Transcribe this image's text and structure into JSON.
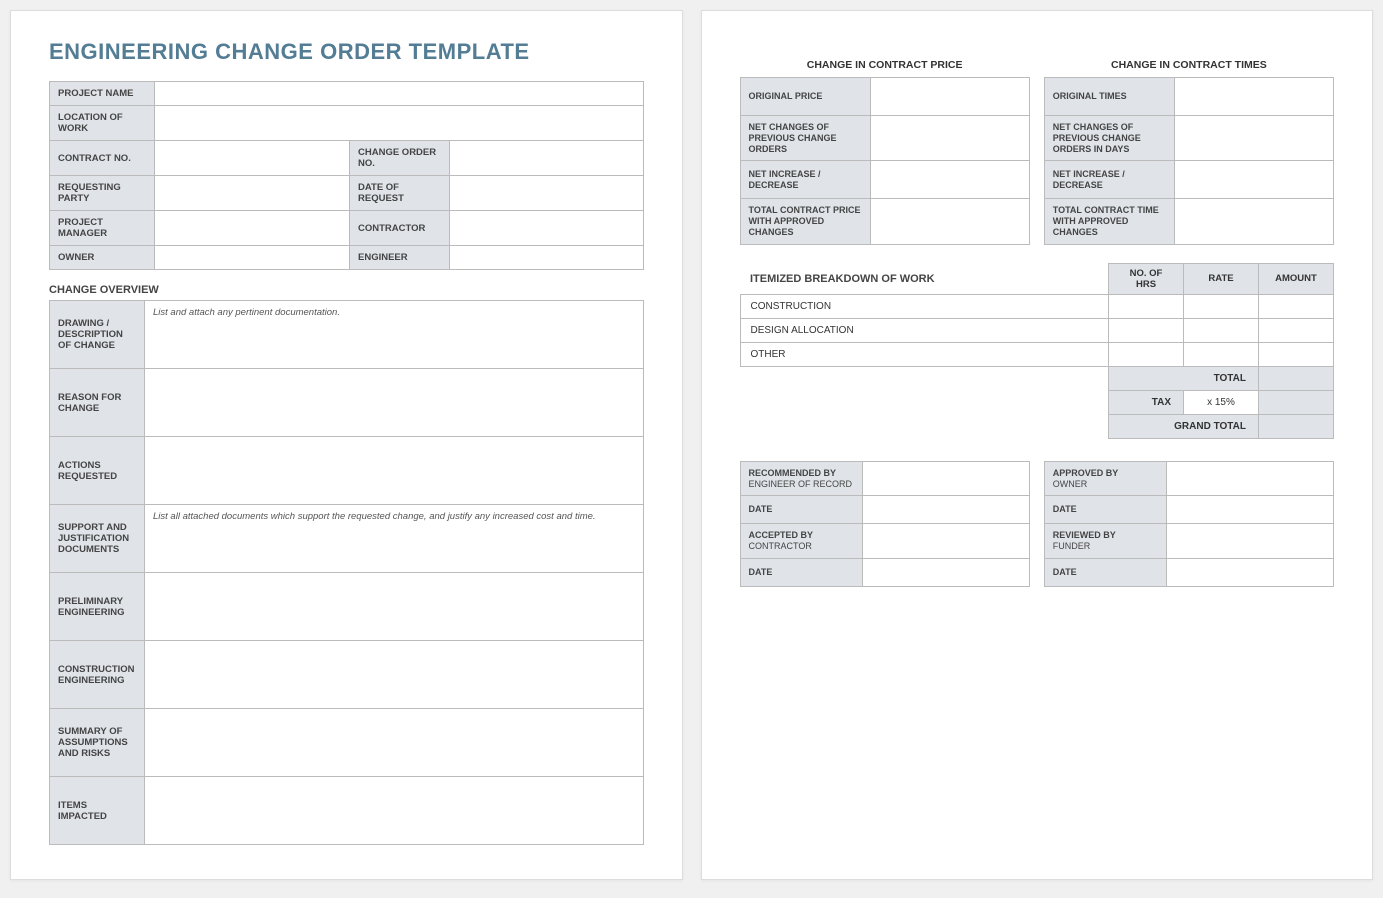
{
  "title": "ENGINEERING CHANGE ORDER TEMPLATE",
  "info": {
    "project_name_label": "PROJECT NAME",
    "project_name_value": "",
    "location_label": "LOCATION OF WORK",
    "location_value": "",
    "contract_no_label": "CONTRACT NO.",
    "contract_no_value": "",
    "change_order_no_label": "CHANGE ORDER NO.",
    "change_order_no_value": "",
    "requesting_party_label": "REQUESTING PARTY",
    "requesting_party_value": "",
    "date_of_request_label": "DATE OF REQUEST",
    "date_of_request_value": "",
    "project_manager_label": "PROJECT MANAGER",
    "project_manager_value": "",
    "contractor_label": "CONTRACTOR",
    "contractor_value": "",
    "owner_label": "OWNER",
    "owner_value": "",
    "engineer_label": "ENGINEER",
    "engineer_value": ""
  },
  "overview_heading": "CHANGE OVERVIEW",
  "overview": {
    "drawing_label": "DRAWING / DESCRIPTION OF CHANGE",
    "drawing_hint": "List and attach any pertinent documentation.",
    "reason_label": "REASON FOR CHANGE",
    "reason_value": "",
    "actions_label": "ACTIONS REQUESTED",
    "actions_value": "",
    "support_label": "SUPPORT AND JUSTIFICATION DOCUMENTS",
    "support_hint": "List all attached documents which support the requested change, and justify any increased cost and time.",
    "prelim_label": "PRELIMINARY ENGINEERING",
    "prelim_value": "",
    "construction_label": "CONSTRUCTION ENGINEERING",
    "construction_value": "",
    "summary_label": "SUMMARY OF ASSUMPTIONS AND RISKS",
    "summary_value": "",
    "items_label": "ITEMS IMPACTED",
    "items_value": ""
  },
  "price": {
    "heading": "CHANGE IN CONTRACT PRICE",
    "original_label": "ORIGINAL PRICE",
    "original_value": "",
    "net_changes_label": "NET CHANGES OF PREVIOUS CHANGE ORDERS",
    "net_changes_value": "",
    "net_inc_label": "NET INCREASE / DECREASE",
    "net_inc_value": "",
    "total_label": "TOTAL CONTRACT PRICE WITH APPROVED CHANGES",
    "total_value": ""
  },
  "times": {
    "heading": "CHANGE IN CONTRACT TIMES",
    "original_label": "ORIGINAL TIMES",
    "original_value": "",
    "net_changes_label": "NET CHANGES OF PREVIOUS CHANGE ORDERS IN DAYS",
    "net_changes_value": "",
    "net_inc_label": "NET INCREASE / DECREASE",
    "net_inc_value": "",
    "total_label": "TOTAL CONTRACT TIME WITH APPROVED CHANGES",
    "total_value": ""
  },
  "breakdown": {
    "heading": "ITEMIZED BREAKDOWN OF WORK",
    "col_hrs": "NO. OF HRS",
    "col_rate": "RATE",
    "col_amount": "AMOUNT",
    "rows": [
      {
        "name": "CONSTRUCTION",
        "hrs": "",
        "rate": "",
        "amount": ""
      },
      {
        "name": "DESIGN ALLOCATION",
        "hrs": "",
        "rate": "",
        "amount": ""
      },
      {
        "name": "OTHER",
        "hrs": "",
        "rate": "",
        "amount": ""
      }
    ],
    "total_label": "TOTAL",
    "total_value": "",
    "tax_label": "TAX",
    "tax_rate": "x 15%",
    "tax_value": "",
    "grand_total_label": "GRAND TOTAL",
    "grand_total_value": ""
  },
  "signatures": {
    "recommended_label": "RECOMMENDED BY",
    "recommended_sub": "ENGINEER OF RECORD",
    "recommended_value": "",
    "recommended_date_label": "DATE",
    "recommended_date_value": "",
    "approved_label": "APPROVED BY",
    "approved_sub": "OWNER",
    "approved_value": "",
    "approved_date_label": "DATE",
    "approved_date_value": "",
    "accepted_label": "ACCEPTED BY",
    "accepted_sub": "CONTRACTOR",
    "accepted_value": "",
    "accepted_date_label": "DATE",
    "accepted_date_value": "",
    "reviewed_label": "REVIEWED BY",
    "reviewed_sub": "FUNDER",
    "reviewed_value": "",
    "reviewed_date_label": "DATE",
    "reviewed_date_value": ""
  }
}
